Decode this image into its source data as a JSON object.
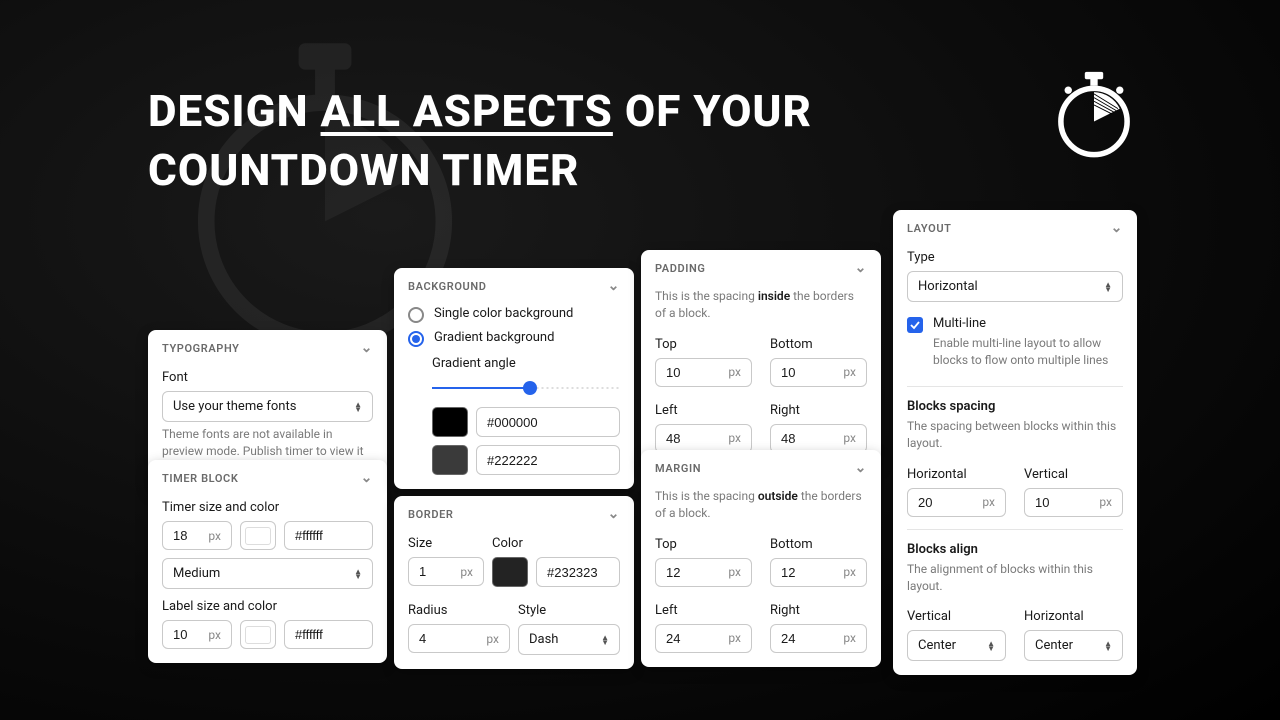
{
  "hero": {
    "line1_pre": "DESIGN ",
    "line1_underline": "ALL ASPECTS",
    "line1_post": " OF YOUR",
    "line2": "COUNTDOWN TIMER"
  },
  "typography": {
    "header": "TYPOGRAPHY",
    "font_label": "Font",
    "font_value": "Use your theme fonts",
    "note": "Theme fonts are not available in preview mode. Publish timer to view it in store."
  },
  "timerblock": {
    "header": "TIMER BLOCK",
    "timer_label": "Timer size and color",
    "timer_size": "18",
    "timer_size_unit": "px",
    "timer_color": "#ffffff",
    "weight_value": "Medium",
    "label_label": "Label size and color",
    "label_size": "10",
    "label_size_unit": "px",
    "label_color": "#ffffff"
  },
  "background": {
    "header": "BACKGROUND",
    "opt_single": "Single color background",
    "opt_gradient": "Gradient background",
    "angle_label": "Gradient angle",
    "slider_percent": 52,
    "color1_hex": "#000000",
    "color1_swatch": "#000000",
    "color2_hex": "#222222",
    "color2_swatch": "#3a3a3a"
  },
  "border": {
    "header": "BORDER",
    "size_label": "Size",
    "size_value": "1",
    "size_unit": "px",
    "color_label": "Color",
    "color_swatch": "#232323",
    "color_hex": "#232323",
    "radius_label": "Radius",
    "radius_value": "4",
    "radius_unit": "px",
    "style_label": "Style",
    "style_value": "Dash"
  },
  "padding": {
    "header": "PADDING",
    "desc_pre": "This is the spacing ",
    "desc_bold": "inside",
    "desc_post": " the borders of a block.",
    "top_label": "Top",
    "top_value": "10",
    "bottom_label": "Bottom",
    "bottom_value": "10",
    "left_label": "Left",
    "left_value": "48",
    "right_label": "Right",
    "right_value": "48",
    "unit": "px"
  },
  "margin": {
    "header": "MARGIN",
    "desc_pre": "This is the spacing ",
    "desc_bold": "outside",
    "desc_post": " the borders of a block.",
    "top_label": "Top",
    "top_value": "12",
    "bottom_label": "Bottom",
    "bottom_value": "12",
    "left_label": "Left",
    "left_value": "24",
    "right_label": "Right",
    "right_value": "24",
    "unit": "px"
  },
  "layout": {
    "header": "LAYOUT",
    "type_label": "Type",
    "type_value": "Horizontal",
    "multi_label": "Multi-line",
    "multi_desc": "Enable multi-line layout to allow blocks to flow onto multiple lines",
    "spacing_heading": "Blocks spacing",
    "spacing_desc": "The spacing between blocks within this layout.",
    "horiz_label": "Horizontal",
    "horiz_value": "20",
    "vert_label": "Vertical",
    "vert_value": "10",
    "unit": "px",
    "align_heading": "Blocks align",
    "align_desc": "The alignment of blocks within this layout.",
    "align_v_label": "Vertical",
    "align_v_value": "Center",
    "align_h_label": "Horizontal",
    "align_h_value": "Center"
  }
}
